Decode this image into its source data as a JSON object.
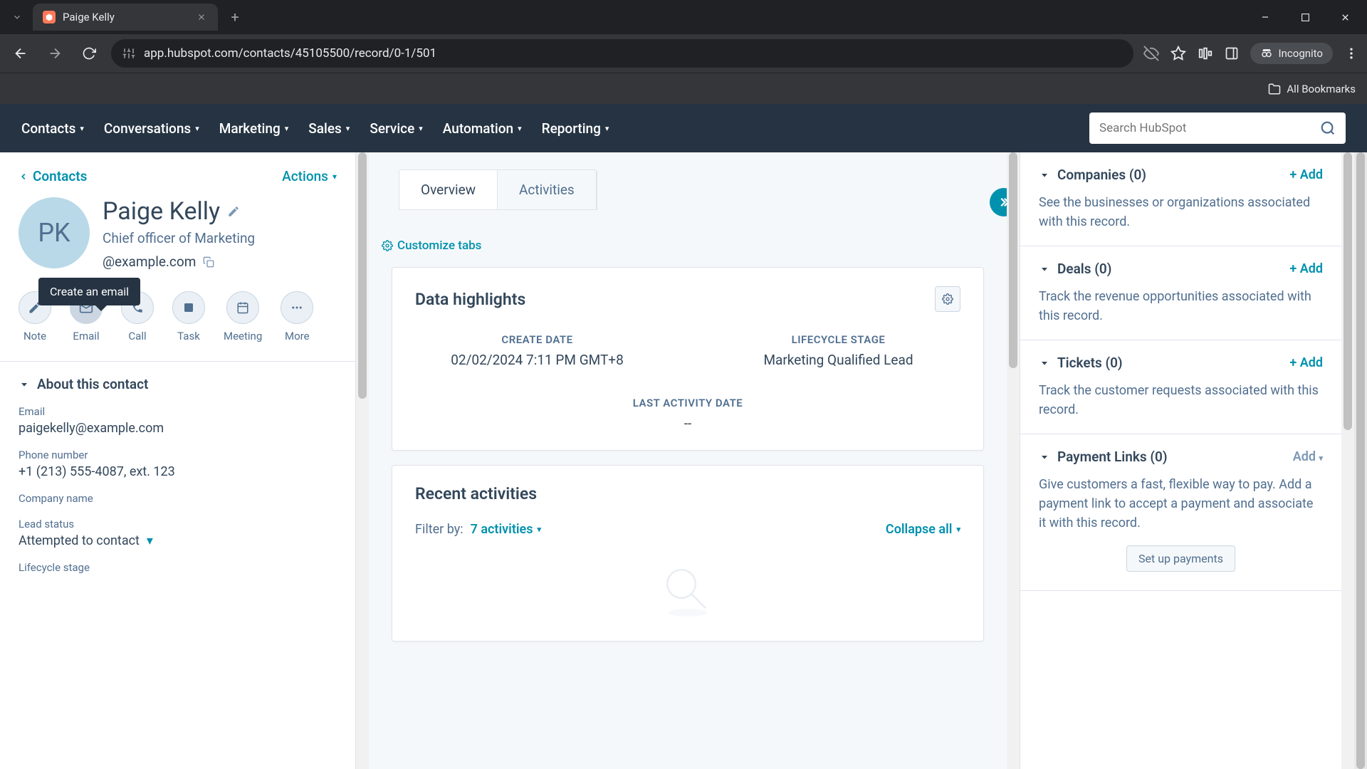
{
  "browser": {
    "tab_title": "Paige Kelly",
    "url": "app.hubspot.com/contacts/45105500/record/0-1/501",
    "incognito": "Incognito",
    "all_bookmarks": "All Bookmarks"
  },
  "nav": {
    "items": [
      "Contacts",
      "Conversations",
      "Marketing",
      "Sales",
      "Service",
      "Automation",
      "Reporting"
    ],
    "search_placeholder": "Search HubSpot"
  },
  "left": {
    "back": "Contacts",
    "actions": "Actions",
    "initials": "PK",
    "name": "Paige Kelly",
    "title": "Chief officer of Marketing",
    "email_display": "@example.com",
    "tooltip": "Create an email",
    "action_buttons": [
      {
        "label": "Note"
      },
      {
        "label": "Email"
      },
      {
        "label": "Call"
      },
      {
        "label": "Task"
      },
      {
        "label": "Meeting"
      },
      {
        "label": "More"
      }
    ],
    "about_header": "About this contact",
    "fields": {
      "email_label": "Email",
      "email_value": "paigekelly@example.com",
      "phone_label": "Phone number",
      "phone_value": "+1 (213) 555-4087, ext. 123",
      "company_label": "Company name",
      "company_value": "",
      "lead_label": "Lead status",
      "lead_value": "Attempted to contact",
      "lifecycle_label": "Lifecycle stage"
    }
  },
  "middle": {
    "tabs": {
      "overview": "Overview",
      "activities": "Activities"
    },
    "customize": "Customize tabs",
    "highlights_title": "Data highlights",
    "highlights": [
      {
        "label": "CREATE DATE",
        "value": "02/02/2024 7:11 PM GMT+8"
      },
      {
        "label": "LIFECYCLE STAGE",
        "value": "Marketing Qualified Lead"
      },
      {
        "label": "LAST ACTIVITY DATE",
        "value": "--"
      }
    ],
    "recent_title": "Recent activities",
    "filter_label": "Filter by:",
    "filter_value": "7 activities",
    "collapse": "Collapse all"
  },
  "right": {
    "sections": [
      {
        "title": "Companies (0)",
        "add": "+ Add",
        "desc": "See the businesses or organizations associated with this record."
      },
      {
        "title": "Deals (0)",
        "add": "+ Add",
        "desc": "Track the revenue opportunities associated with this record."
      },
      {
        "title": "Tickets (0)",
        "add": "+ Add",
        "desc": "Track the customer requests associated with this record."
      },
      {
        "title": "Payment Links (0)",
        "add": "Add",
        "desc": "Give customers a fast, flexible way to pay. Add a payment link to accept a payment and associate it with this record.",
        "button": "Set up payments"
      }
    ]
  }
}
